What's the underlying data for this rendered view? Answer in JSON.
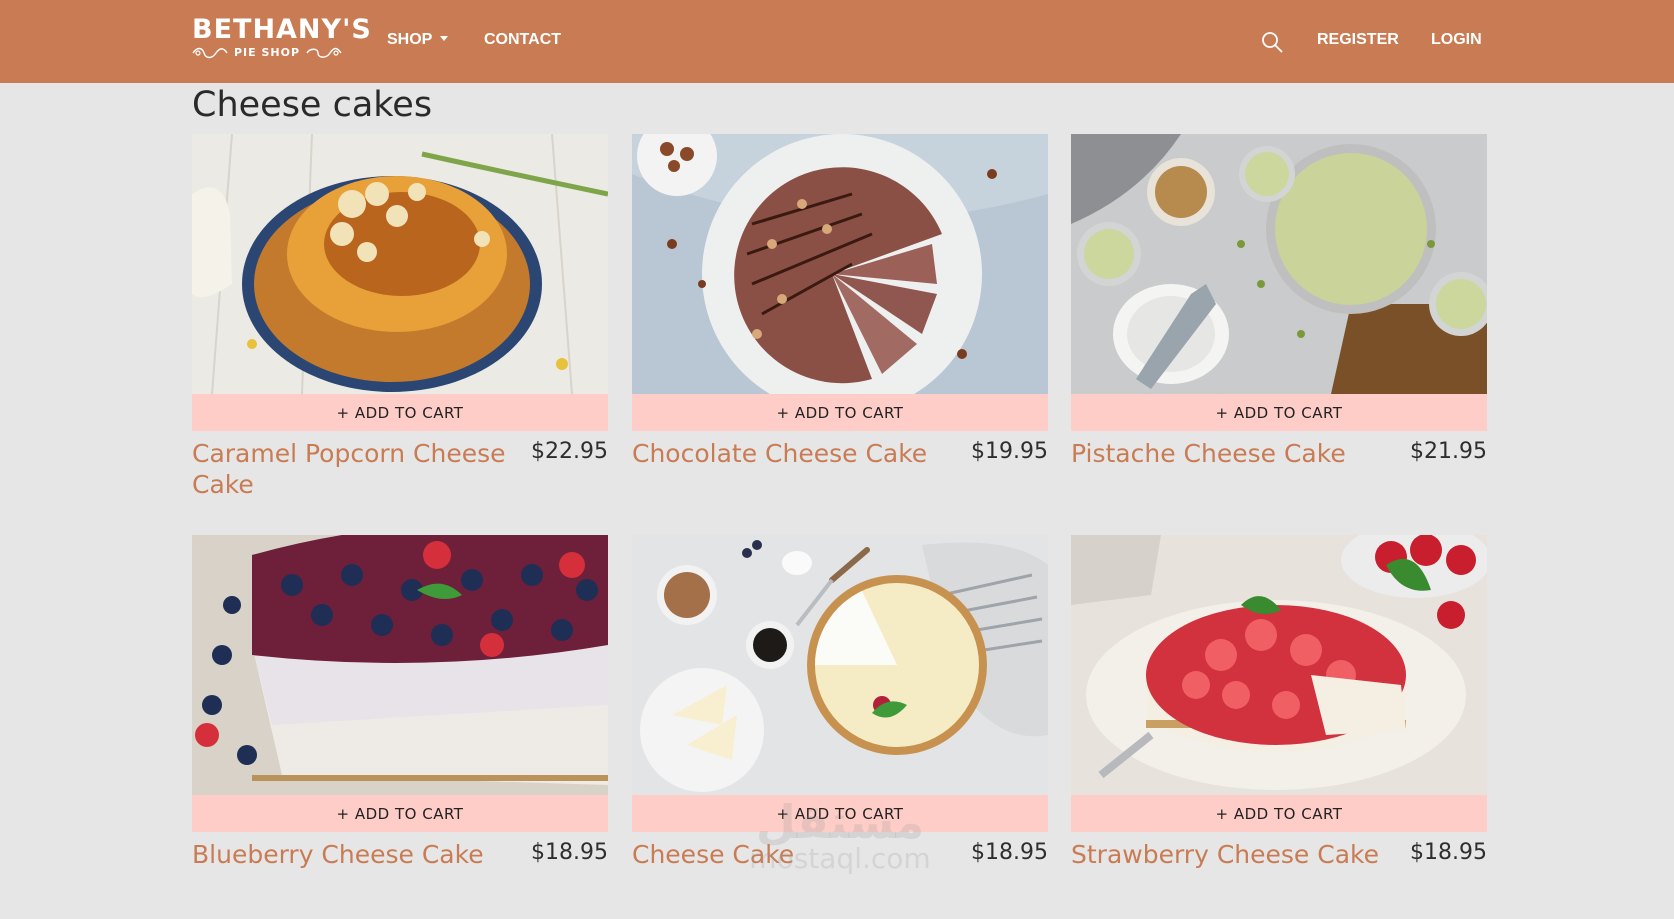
{
  "brand": {
    "name": "BETHANY'S",
    "tagline": "PIE SHOP"
  },
  "nav": {
    "shop": "SHOP",
    "contact": "CONTACT",
    "search_icon": "search-icon",
    "register": "REGISTER",
    "login": "LOGIN"
  },
  "colors": {
    "navbar": "#c97c54",
    "accent": "#c97c54",
    "cart_button": "#ffcdc7",
    "background": "#e6e6e6"
  },
  "page": {
    "title": "Cheese cakes"
  },
  "products": [
    {
      "name": "Caramel Popcorn Cheese Cake",
      "price": "$22.95",
      "cart_label": "+ ADD TO CART"
    },
    {
      "name": "Chocolate Cheese Cake",
      "price": "$19.95",
      "cart_label": "+ ADD TO CART"
    },
    {
      "name": "Pistache Cheese Cake",
      "price": "$21.95",
      "cart_label": "+ ADD TO CART"
    },
    {
      "name": "Blueberry Cheese Cake",
      "price": "$18.95",
      "cart_label": "+ ADD TO CART"
    },
    {
      "name": "Cheese Cake",
      "price": "$18.95",
      "cart_label": "+ ADD TO CART"
    },
    {
      "name": "Strawberry Cheese Cake",
      "price": "$18.95",
      "cart_label": "+ ADD TO CART"
    }
  ],
  "watermark": {
    "arabic": "مستقل",
    "latin": "mostaql.com"
  }
}
